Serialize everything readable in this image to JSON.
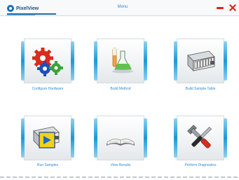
{
  "app": {
    "logo_text": "PixelView",
    "window_title": "Menu"
  },
  "tiles": [
    {
      "label": "Configure Hardware",
      "icon": "gears-icon"
    },
    {
      "label": "Build Method",
      "icon": "lab-flasks-icon"
    },
    {
      "label": "Build Sample Table",
      "icon": "sample-rack-icon"
    },
    {
      "label": "Run Samples",
      "icon": "run-play-icon"
    },
    {
      "label": "View Results",
      "icon": "open-book-icon"
    },
    {
      "label": "Perform Diagnostics",
      "icon": "tools-icon"
    }
  ],
  "colors": {
    "accent": "#1a9ad8",
    "label": "#2f8ad0",
    "close": "#e32018"
  }
}
